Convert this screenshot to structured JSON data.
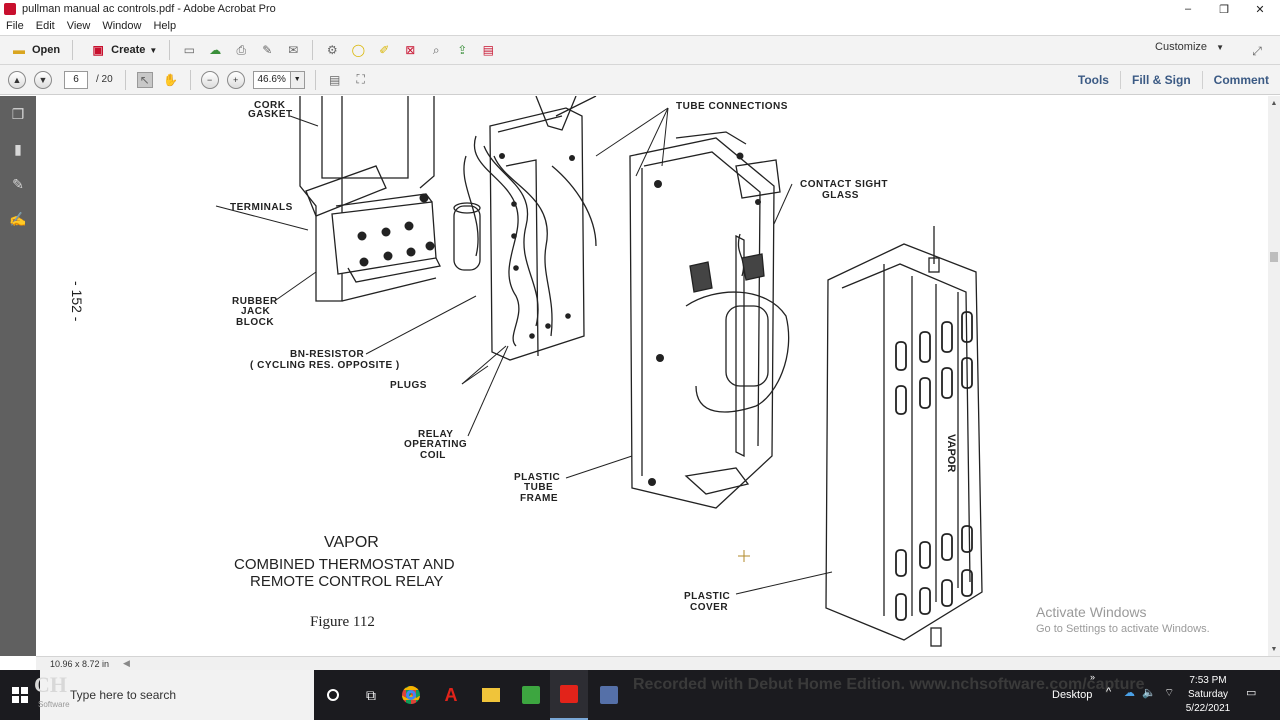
{
  "window": {
    "title": "pullman manual ac controls.pdf - Adobe Acrobat Pro",
    "minimize": "‒",
    "restore": "❐",
    "close": "✕"
  },
  "menu": [
    "File",
    "Edit",
    "View",
    "Window",
    "Help"
  ],
  "toolbar": {
    "open_label": "Open",
    "create_label": "Create",
    "customize_label": "Customize"
  },
  "nav": {
    "page_current": "6",
    "page_total": "/ 20",
    "zoom": "46.6%"
  },
  "panels": {
    "tools": "Tools",
    "fill_sign": "Fill & Sign",
    "comment": "Comment"
  },
  "document": {
    "page_number": "- 152 -",
    "labels": {
      "cork_gasket_1": "CORK",
      "cork_gasket_2": "GASKET",
      "terminals": "TERMINALS",
      "rubber_1": "RUBBER",
      "rubber_2": "JACK",
      "rubber_3": "BLOCK",
      "bn_resistor": "BN-RESISTOR",
      "cycling": "( CYCLING RES. OPPOSITE )",
      "plugs": "PLUGS",
      "relay_1": "RELAY",
      "relay_2": "OPERATING",
      "relay_3": "COIL",
      "tube_connections": "TUBE CONNECTIONS",
      "contact_1": "CONTACT SIGHT",
      "contact_2": "GLASS",
      "plastic_frame_1": "PLASTIC",
      "plastic_frame_2": "TUBE",
      "plastic_frame_3": "FRAME",
      "plastic_cover_1": "PLASTIC",
      "plastic_cover_2": "COVER",
      "vapor_mark": "VAPOR"
    },
    "caption": {
      "line1": "VAPOR",
      "line2": "COMBINED THERMOSTAT AND",
      "line3": "REMOTE CONTROL RELAY",
      "figure": "Figure 112"
    }
  },
  "status": {
    "page_size": "10.96 x 8.72 in"
  },
  "activation": {
    "title": "Activate Windows",
    "subtitle": "Go to Settings to activate Windows."
  },
  "taskbar": {
    "search_placeholder": "Type here to search",
    "recorder_watermark": "Recorded with Debut Home Edition. www.nchsoftware.com/capture",
    "logo_text": "CH",
    "logo_sub": "Software",
    "desktop_label": "Desktop",
    "time": "7:53 PM",
    "day": "Saturday",
    "date": "5/22/2021"
  }
}
